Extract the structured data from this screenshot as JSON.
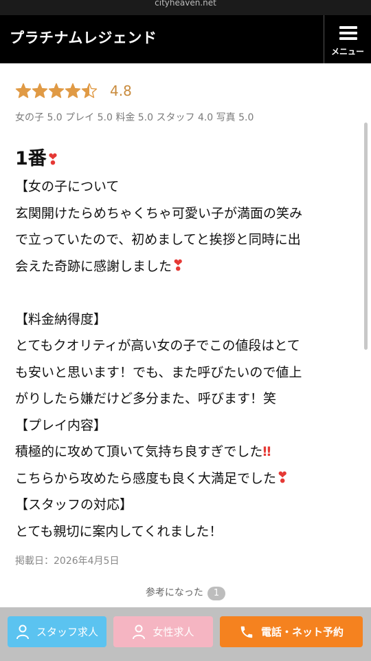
{
  "browser": {
    "url": "cityheaven.net"
  },
  "header": {
    "title": "プラチナムレジェンド",
    "menu_label": "メニュー"
  },
  "review": {
    "stars": 4.5,
    "score": "4.8",
    "sub_ratings": "女の子 5.0 プレイ 5.0 料金 5.0 スタッフ 4.0 写真 5.0",
    "title": "1番",
    "lines": [
      "【女の子について",
      "玄関開けたらめちゃくちゃ可愛い子が満面の笑み",
      "で立っていたので、初めましてと挨拶と同時に出",
      "会えた奇跡に感謝しました",
      "",
      "【料金納得度】",
      "とてもクオリティが高い女の子でこの値段はとて",
      "も安いと思います！でも、また呼びたいので値上",
      "がりしたら嫌だけど多分また、呼びます！笑",
      "【プレイ内容】",
      "積極的に攻めて頂いて気持ち良すぎでした",
      "こちらから攻めたら感度も良く大満足でした",
      "【スタッフの対応】",
      "とても親切に案内してくれました！"
    ],
    "posted_date": "掲載日：2026年4月5日",
    "helpful_label": "参考になった",
    "helpful_count": "1"
  },
  "bottom_bar": {
    "staff_recruit": "スタッフ求人",
    "female_recruit": "女性求人",
    "phone_net_reserve": "電話・ネット予約"
  },
  "colors": {
    "star": "#e09a45",
    "score": "#c98b3d",
    "staff": "#5bc3f0",
    "female": "#f5b5c2",
    "phone": "#f5821f",
    "heart": "#e53935"
  }
}
